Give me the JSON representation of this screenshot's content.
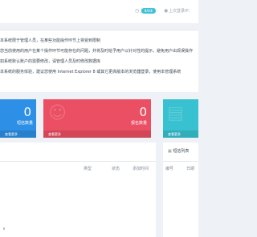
{
  "topbar": {
    "last_login_label": "上次登录：",
    "last_login_badge": "BASE",
    "last_login_ip_label": "上次登录IP："
  },
  "notice": {
    "lines": [
      "本系统限于管理人员，在某些功能操作环节上将受到限制",
      "您当前使用的用户在某个操作环节可能存在的问题，并将及时给予用户以针对性的提示，避免用户出现误操作",
      "如系统默认账户的需要修改，请管理人员及时修改数据库",
      "本系统的服务体验，建议您使用 Internet Explorer 8 或其它更高版本的浏览器登录，使用本管理系统"
    ]
  },
  "cards": [
    {
      "value": "0",
      "label": "短信数量",
      "more": "查看更多"
    },
    {
      "value": "0",
      "label": "报名数量",
      "more": "查看更多"
    },
    {
      "value": "",
      "label": "",
      "more": "查看更多"
    }
  ],
  "table": {
    "columns": [
      "类型",
      "状态",
      "添加时间"
    ]
  },
  "right_panel": {
    "title": "短信列表",
    "columns": [
      "编号",
      "日期"
    ]
  }
}
